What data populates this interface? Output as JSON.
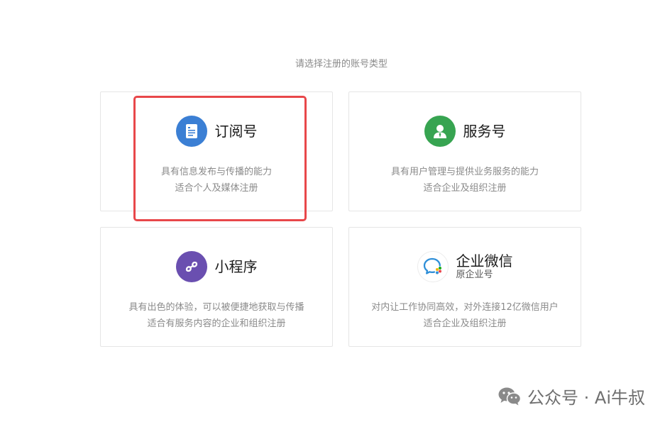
{
  "prompt": "请选择注册的账号类型",
  "cards": [
    {
      "title": "订阅号",
      "subtitle": "",
      "desc": [
        "具有信息发布与传播的能力",
        "适合个人及媒体注册"
      ],
      "icon": "document-icon",
      "color": "#3b7fd4"
    },
    {
      "title": "服务号",
      "subtitle": "",
      "desc": [
        "具有用户管理与提供业务服务的能力",
        "适合企业及组织注册"
      ],
      "icon": "person-icon",
      "color": "#37a451"
    },
    {
      "title": "小程序",
      "subtitle": "",
      "desc": [
        "具有出色的体验，可以被便捷地获取与传播",
        "适合有服务内容的企业和组织注册"
      ],
      "icon": "link-icon",
      "color": "#6a4fb0"
    },
    {
      "title": "企业微信",
      "subtitle": "原企业号",
      "desc": [
        "对内让工作协同高效，对外连接12亿微信用户",
        "适合企业及组织注册"
      ],
      "icon": "chat-icon",
      "color": "#2f8fd8"
    }
  ],
  "highlight_color": "#e8474a",
  "watermark": "公众号 · Ai牛叔"
}
